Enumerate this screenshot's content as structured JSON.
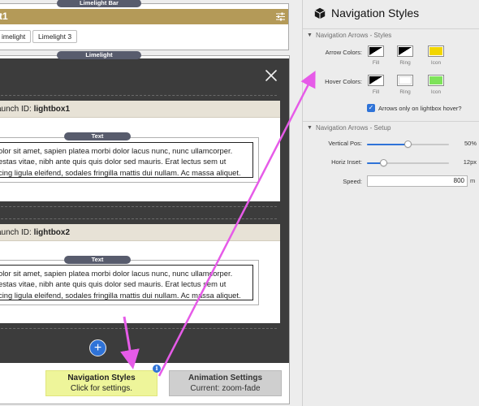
{
  "editor": {
    "limelight_bar_tag": "Limelight Bar",
    "limelight_bar_title": "t1",
    "chips": [
      "imelight",
      "Limelight 3"
    ],
    "limelight_tag": "Limelight",
    "lightbox1": {
      "launch_prefix": "aunch ID: ",
      "launch_id": "lightbox1",
      "text_tag": "Text",
      "lines": [
        "olor sit amet, sapien platea morbi dolor lacus nunc, nunc ullamcorper.",
        "estas vitae, nibh ante quis quis dolor sed mauris. Erat lectus sem ut",
        "cing ligula eleifend, sodales fringilla mattis dui nullam. Ac massa aliquet."
      ]
    },
    "lightbox2": {
      "launch_prefix": "aunch ID: ",
      "launch_id": "lightbox2",
      "text_tag": "Text",
      "lines": [
        "olor sit amet, sapien platea morbi dolor lacus nunc, nunc ullamcorper.",
        "estas vitae, nibh ante quis quis dolor sed mauris. Erat lectus sem ut",
        "cing ligula eleifend, sodales fringilla mattis dui nullam. Ac massa aliquet."
      ]
    },
    "add_glyph": "+",
    "info_glyph": "i",
    "nav_button": {
      "title": "Navigation Styles",
      "subtitle": "Click for settings."
    },
    "anim_button": {
      "title": "Animation Settings",
      "subtitle": "Current: zoom-fade"
    }
  },
  "inspector": {
    "title": "Navigation Styles",
    "section1": "Navigation Arrows - Styles",
    "arrow_colors_label": "Arrow Colors:",
    "hover_colors_label": "Hover Colors:",
    "swatch_labels": [
      "Fill",
      "Ring",
      "Icon"
    ],
    "arrow_colors": [
      "#000000",
      "#ffffff",
      "#f2d600"
    ],
    "hover_colors": [
      "#000000",
      "#ffffff",
      "#7ee35a"
    ],
    "checkbox_label": "Arrows only on lightbox hover?",
    "checkbox_checked": true,
    "section2": "Navigation Arrows - Setup",
    "vertical_pos": {
      "label": "Vertical Pos:",
      "value": "50%",
      "fraction": 0.5
    },
    "horiz_inset": {
      "label": "Horiz Inset:",
      "value": "12px",
      "fraction": 0.2
    },
    "speed": {
      "label": "Speed:",
      "value": "800",
      "unit": "m"
    }
  },
  "colors": {
    "gold_bar": "#b49a58",
    "nav_button_bg": "#eef59a",
    "accent_blue": "#2f73d8",
    "annotation_arrow": "#e65be8"
  },
  "icons": [
    "sliders-icon",
    "close-icon",
    "plus-icon",
    "info-icon",
    "cube-icon",
    "checkmark-icon",
    "disclosure-triangle-icon"
  ]
}
